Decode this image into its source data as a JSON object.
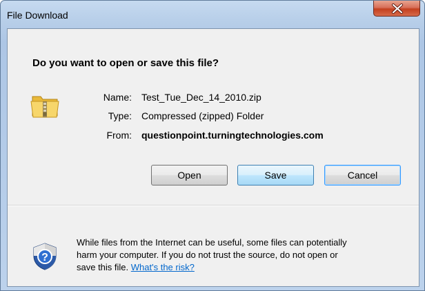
{
  "window": {
    "title": "File Download",
    "close_glyph": "X"
  },
  "dialog": {
    "question": "Do you want to open or save this file?",
    "icon": "zip-folder-icon",
    "fields": {
      "name_label": "Name:",
      "name_value": "Test_Tue_Dec_14_2010.zip",
      "type_label": "Type:",
      "type_value": "Compressed (zipped) Folder",
      "from_label": "From:",
      "from_value": "questionpoint.turningtechnologies.com"
    },
    "buttons": {
      "open": "Open",
      "save": "Save",
      "cancel": "Cancel"
    },
    "warning": {
      "icon": "security-shield-icon",
      "line1": "While files from the Internet can be useful, some files can potentially",
      "line2": "harm your computer. If you do not trust the source, do not open or",
      "line3_prefix": "save this file.",
      "link": "What's the risk?"
    }
  },
  "colors": {
    "frame": "#bcd2ec",
    "client": "#f0f0f0",
    "close_button": "#c4401f",
    "link": "#0066cc"
  }
}
